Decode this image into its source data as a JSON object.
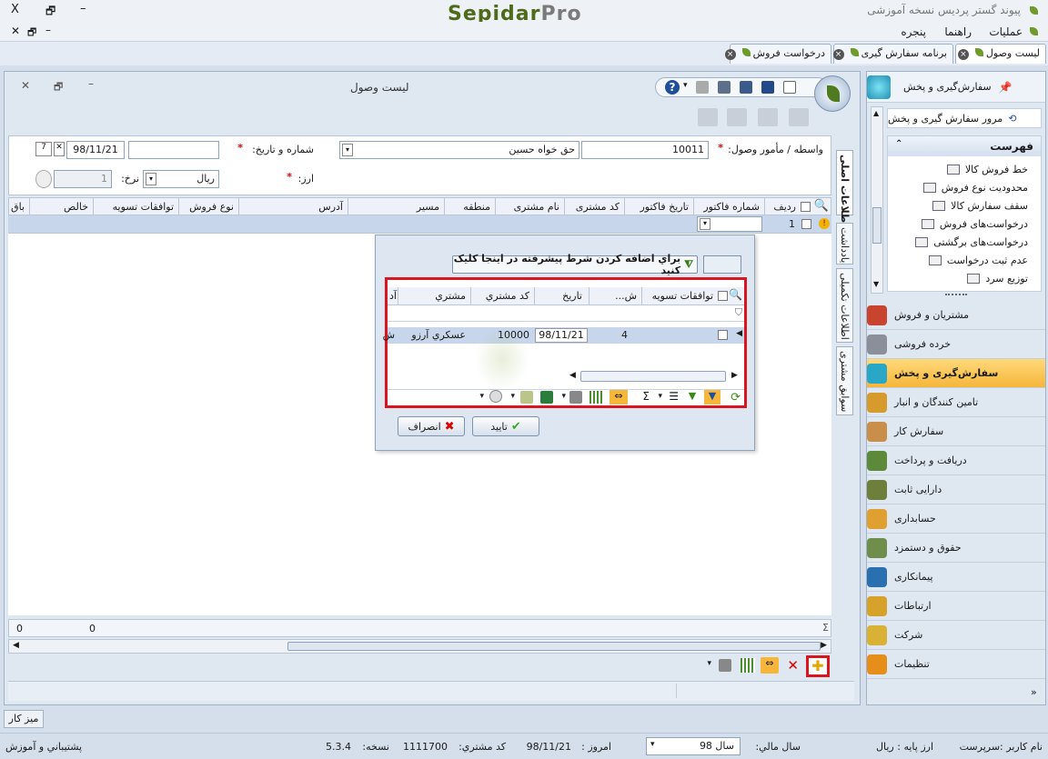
{
  "app": {
    "title": "پیوند گستر پردیس نسخه آموزشی",
    "logo_a": "Sepidar",
    "logo_b": "Pro",
    "window_controls": {
      "close": "X",
      "restore": "🗗",
      "minimize": "–"
    }
  },
  "menu": {
    "items": [
      "عملیات",
      "راهنما",
      "پنجره"
    ]
  },
  "tabs": [
    {
      "label": "لیست وصول",
      "active": true
    },
    {
      "label": "برنامه سفارش گیری",
      "active": false
    },
    {
      "label": "درخواست فروش",
      "active": false
    }
  ],
  "window": {
    "title": "لیست وصول"
  },
  "form": {
    "agent_label": "واسطه / مأمور وصول:",
    "agent_code": "10011",
    "agent_name": "حق خواه حسین",
    "number_date_label": "شماره و تاریخ:",
    "number_value": "",
    "date_value": "98/11/21",
    "currency_label": "ارز:",
    "currency_value": "ریال",
    "rate_label": "نرخ:",
    "rate_value": "1"
  },
  "grid": {
    "columns": [
      "ردیف",
      "شماره فاکتور",
      "تاریخ فاکتور",
      "کد مشتری",
      "نام مشتری",
      "منطقه",
      "مسیر",
      "آدرس",
      "نوع فروش",
      "توافقات تسویه",
      "خالص",
      "باق"
    ],
    "row1": {
      "index": "1"
    },
    "sum_left": "0",
    "sum_mid": "0"
  },
  "side_tabs": [
    "اطلاعات اصلی",
    "یادداشت",
    "اطلاعات تکمیلی",
    "سوابق مشتری"
  ],
  "popup": {
    "filter_hint": "براي اضافه کردن شرط پیشرفته در اینجا کلیک کنید",
    "columns": [
      "توافقات تسویه",
      "ش...",
      "تاریخ",
      "کد مشتري",
      "مشتري",
      "آد"
    ],
    "row": {
      "settlement": "",
      "num": "4",
      "date": "98/11/21",
      "code": "10000",
      "customer": "عسكري آرزو",
      "extra": "ش"
    },
    "ok_label": "تایید",
    "cancel_label": "انصراف"
  },
  "right_panel": {
    "title": "سفارش‌گیری و پخش",
    "overview": "مرور سفارش گیری و پخش",
    "list_title": "فهرست",
    "list_items": [
      "خط فروش کالا",
      "محدودیت نوع فروش",
      "سقف سفارش کالا",
      "درخواست‌های فروش",
      "درخواست‌های برگشتی",
      "عدم ثبت درخواست",
      "توزیع سرد"
    ],
    "nav": [
      {
        "label": "مشتریان و فروش",
        "color": "#c9442e"
      },
      {
        "label": "خرده فروشی",
        "color": "#8a8f99"
      },
      {
        "label": "سفارش‌گیری و پخش",
        "color": "#2aa6c7",
        "active": true
      },
      {
        "label": "تامین کنندگان و انبار",
        "color": "#d69a2d"
      },
      {
        "label": "سفارش کار",
        "color": "#c98f4a"
      },
      {
        "label": "دریافت و پرداخت",
        "color": "#5c8a3a"
      },
      {
        "label": "دارایی ثابت",
        "color": "#6d7f3b"
      },
      {
        "label": "حسابداری",
        "color": "#e0a030"
      },
      {
        "label": "حقوق و دستمزد",
        "color": "#6f8e4c"
      },
      {
        "label": "پیمانکاری",
        "color": "#2a6fb0"
      },
      {
        "label": "ارتباطات",
        "color": "#d6a22a"
      },
      {
        "label": "شرکت",
        "color": "#d9b134"
      },
      {
        "label": "تنظیمات",
        "color": "#e58e1a"
      }
    ]
  },
  "desk_label": "میز کار",
  "status": {
    "user": "نام كاربر :سرپرست",
    "base_currency": "ارز پايه :  ريال",
    "fiscal_year_label": "سال مالي:",
    "fiscal_year_value": "سال 98",
    "today_label": "امروز :",
    "today_value": "98/11/21",
    "customer_code_label": "کد مشتري:",
    "customer_code_value": "1111700",
    "version_label": "نسخه:",
    "version_value": "5.3.4",
    "support": "پشتیباني و آموزش"
  },
  "colors": {
    "highlight": "#d9151f",
    "brand_green": "#6c8c2a",
    "selection": "#c7d6ea"
  }
}
